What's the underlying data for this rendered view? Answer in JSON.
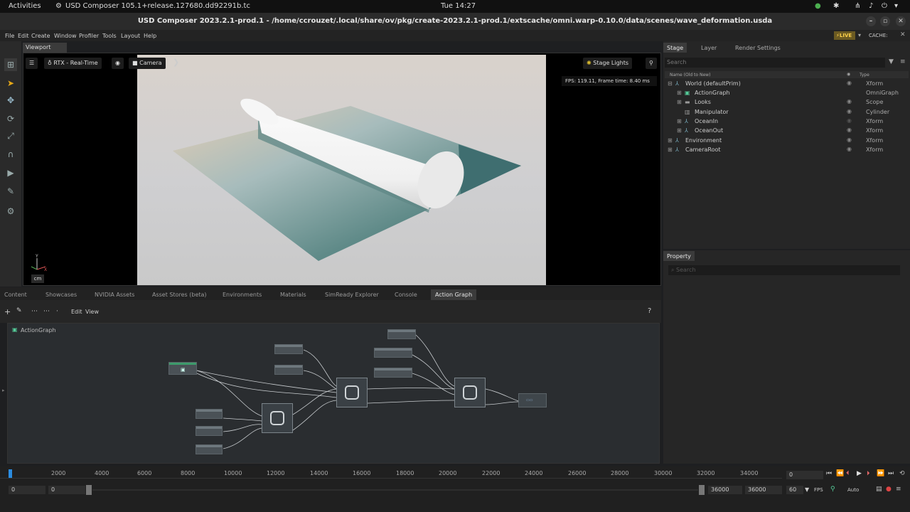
{
  "system": {
    "activities": "Activities",
    "app_name": "USD Composer 105.1+release.127680.dd92291b.tc",
    "clock": "Tue 14:27"
  },
  "window": {
    "title": "USD Composer 2023.2.1-prod.1 - /home/ccrouzet/.local/share/ov/pkg/create-2023.2.1-prod.1/extscache/omni.warp-0.10.0/data/scenes/wave_deformation.usda"
  },
  "menu": [
    "File",
    "Edit",
    "Create",
    "Window",
    "Profiler",
    "Tools",
    "Layout",
    "Help"
  ],
  "status": {
    "live": "LIVE",
    "cache": "CACHE:"
  },
  "viewport": {
    "tab": "Viewport",
    "renderer": "RTX - Real-Time",
    "camera": "Camera",
    "stage_lights": "Stage Lights",
    "fps": "FPS: 119.11, Frame time: 8.40 ms",
    "units": "cm"
  },
  "stage": {
    "tabs": [
      "Stage",
      "Layer",
      "Render Settings"
    ],
    "search_placeholder": "Search",
    "col_name": "Name (Old to New)",
    "col_type": "Type",
    "rows": [
      {
        "name": "World (defaultPrim)",
        "type": "Xform"
      },
      {
        "name": "ActionGraph",
        "type": "OmniGraph"
      },
      {
        "name": "Looks",
        "type": "Scope"
      },
      {
        "name": "Manipulator",
        "type": "Cylinder"
      },
      {
        "name": "OceanIn",
        "type": "Xform"
      },
      {
        "name": "OceanOut",
        "type": "Xform"
      },
      {
        "name": "Environment",
        "type": "Xform"
      },
      {
        "name": "CameraRoot",
        "type": "Xform"
      }
    ]
  },
  "property": {
    "tab": "Property",
    "search_placeholder": "Search"
  },
  "bottom_tabs": [
    "Content",
    "Showcases",
    "NVIDIA Assets",
    "Asset Stores (beta)",
    "Environments",
    "Materials",
    "SimReady Explorer",
    "Console",
    "Action Graph"
  ],
  "graph": {
    "edit": "Edit",
    "view": "View",
    "name": "ActionGraph",
    "help": "?"
  },
  "timeline": {
    "ticks": [
      "2000",
      "4000",
      "6000",
      "8000",
      "10000",
      "12000",
      "14000",
      "16000",
      "18000",
      "20000",
      "22000",
      "24000",
      "26000",
      "28000",
      "30000",
      "32000",
      "34000"
    ],
    "current_frame": "0",
    "start": "0",
    "start2": "0",
    "end": "36000",
    "end2": "36000",
    "fps_value": "60",
    "fps_label": "FPS",
    "auto": "Auto"
  }
}
